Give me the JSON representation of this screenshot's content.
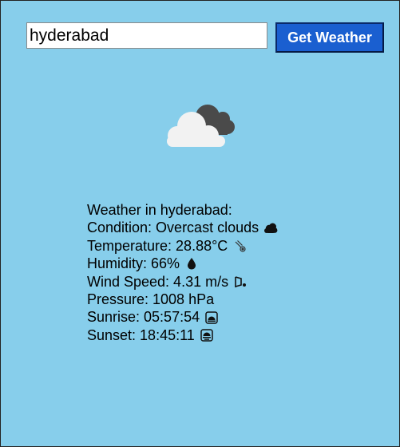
{
  "search": {
    "value": "hyderabad",
    "button_label": "Get Weather"
  },
  "weather": {
    "icon": "overcast-clouds-icon",
    "heading": "Weather in hyderabad:",
    "condition": "Condition: Overcast clouds",
    "condition_icon": "cloud-icon",
    "temperature": "Temperature: 28.88°C",
    "temperature_icon": "thermometer-icon",
    "humidity": "Humidity: 66%",
    "humidity_icon": "droplet-icon",
    "wind_speed": "Wind Speed: 4.31 m/s",
    "wind_icon": "wind-icon",
    "pressure": "Pressure: 1008 hPa",
    "sunrise": "Sunrise: 05:57:54",
    "sunrise_icon": "sunrise-icon",
    "sunset": "Sunset: 18:45:11",
    "sunset_icon": "sunset-icon"
  },
  "colors": {
    "background": "#87ceeb",
    "button": "#1a5fd0",
    "button_text": "#ffffff"
  }
}
